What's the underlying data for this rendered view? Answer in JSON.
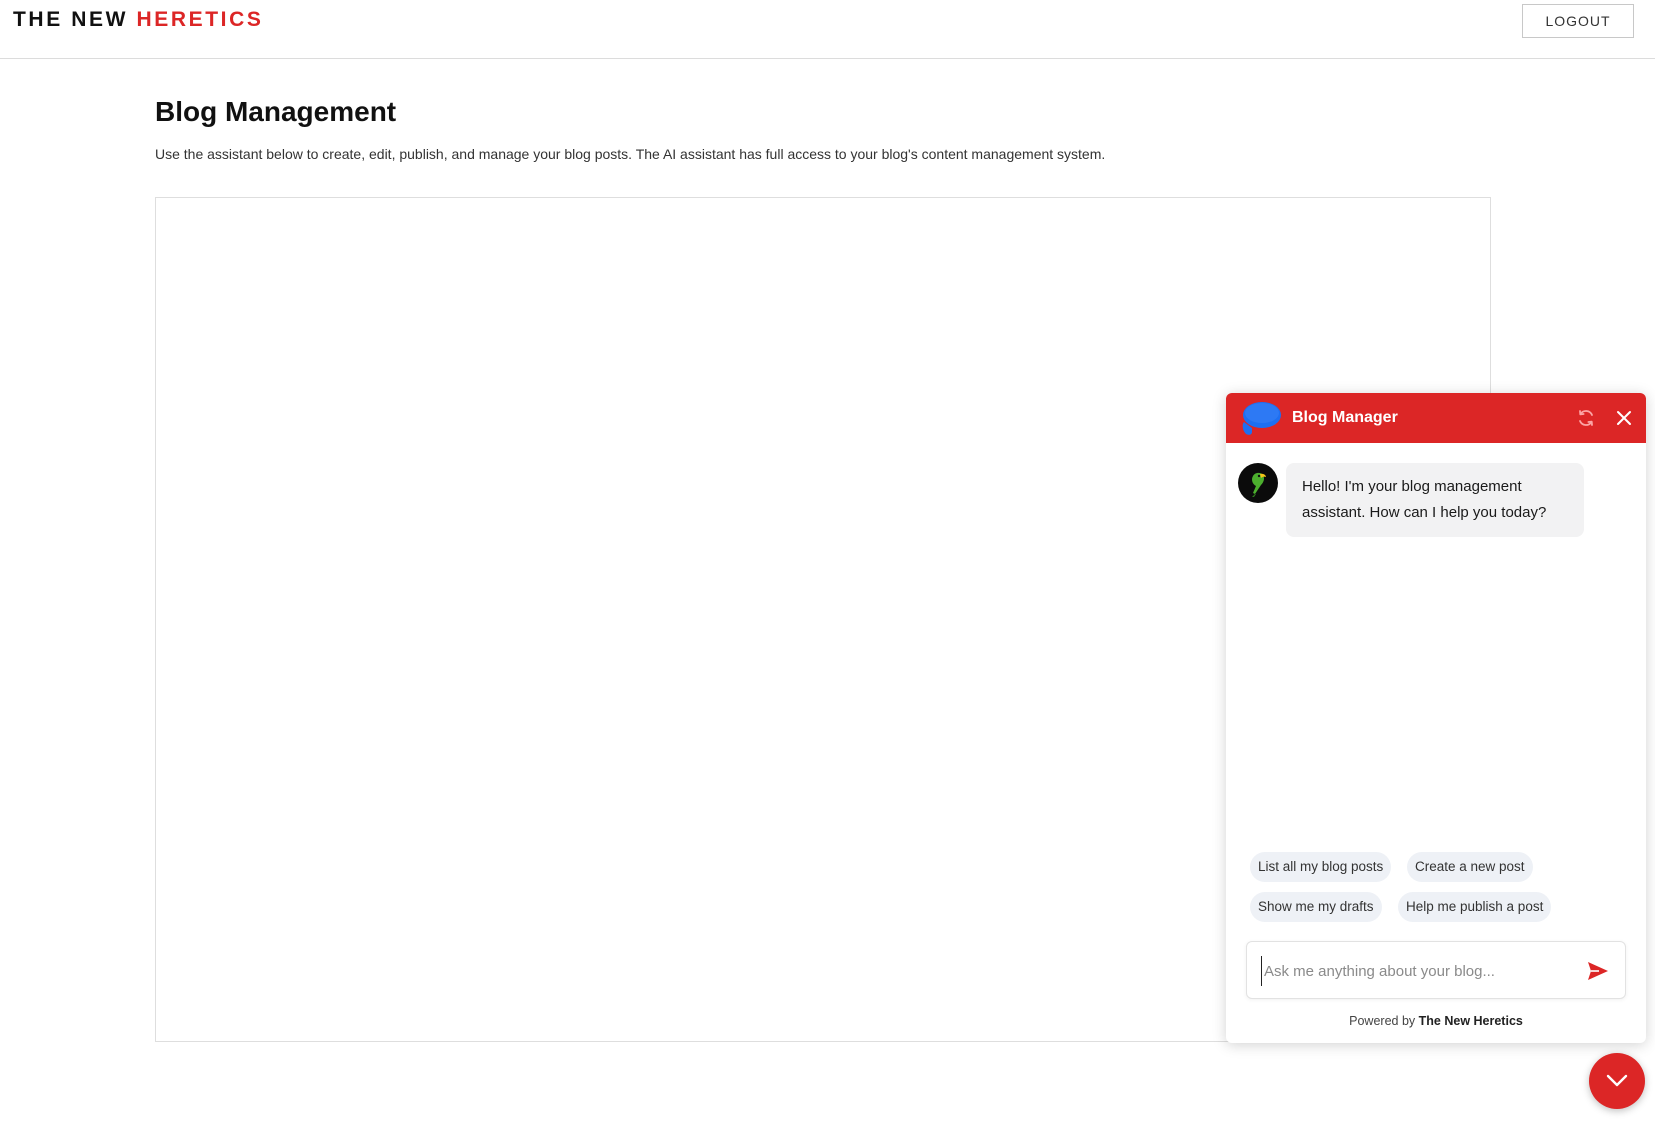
{
  "header": {
    "brand_part1": "THE NEW",
    "brand_part2": "HERETICS",
    "logout_label": "LOGOUT"
  },
  "main": {
    "title": "Blog Management",
    "description": "Use the assistant below to create, edit, publish, and manage your blog posts. The AI assistant has full access to your blog's content management system."
  },
  "chat": {
    "title": "Blog Manager",
    "header_icons": [
      "chat-bubble-logo-icon",
      "refresh-icon",
      "close-icon"
    ],
    "avatar_icon": "parrot-icon",
    "messages": [
      {
        "role": "assistant",
        "text": "Hello! I'm your blog management assistant. How can I help you today?"
      }
    ],
    "suggestions": [
      "List all my blog posts",
      "Create a new post",
      "Show me my drafts",
      "Help me publish a post"
    ],
    "input": {
      "value": "",
      "placeholder": "Ask me anything about your blog..."
    },
    "send_icon": "send-icon",
    "powered_by_prefix": "Powered by",
    "powered_by_brand": "The New Heretics"
  },
  "toggle_icon": "chevron-down-icon",
  "colors": {
    "accent": "#dc2626",
    "logo_blue": "#1d6ff2",
    "chip_background": "#eef1f6",
    "bubble_background": "#f2f2f3"
  }
}
